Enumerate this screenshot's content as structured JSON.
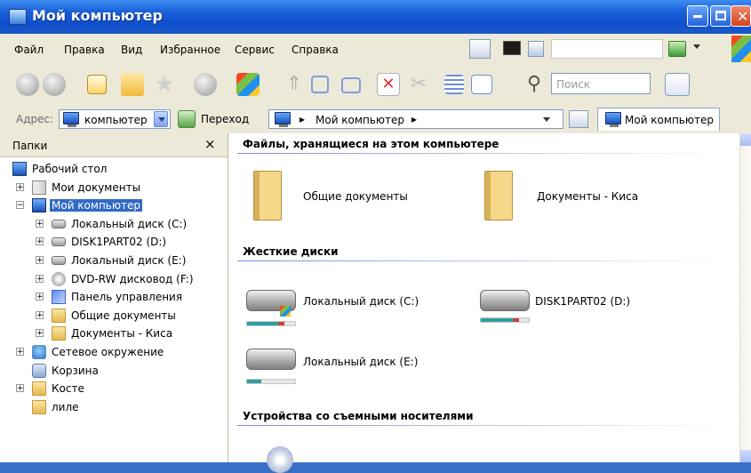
{
  "window": {
    "title": "Мой компьютер"
  },
  "menu": [
    "Файл",
    "Правка",
    "Вид",
    "Избранное",
    "Сервис",
    "Справка"
  ],
  "toolbar": {
    "search_placeholder": "Поиск"
  },
  "address": {
    "label": "Адрес:",
    "combo_value": "компьютер",
    "go_label": "Переход",
    "path": "Мой компьютер",
    "tab": "Мой компьютер"
  },
  "folders_pane": {
    "title": "Папки",
    "close_glyph": "×",
    "tree": [
      {
        "label": "Рабочий стол",
        "icon": "desktop-icon",
        "expander": ""
      },
      {
        "label": "Мои документы",
        "icon": "my-documents-icon",
        "expander": "+"
      },
      {
        "label": "Мой компьютер",
        "icon": "computer-icon",
        "expander": "−",
        "selected": true
      },
      {
        "label": "Локальный диск (C:)",
        "icon": "disk-icon",
        "expander": "+"
      },
      {
        "label": "DISK1PART02 (D:)",
        "icon": "disk-icon",
        "expander": "+"
      },
      {
        "label": "Локальный диск (E:)",
        "icon": "disk-icon",
        "expander": "+"
      },
      {
        "label": "DVD-RW дисковод (F:)",
        "icon": "dvd-icon",
        "expander": "+"
      },
      {
        "label": "Панель управления",
        "icon": "control-panel-icon",
        "expander": "+"
      },
      {
        "label": "Общие документы",
        "icon": "folder-icon",
        "expander": "+"
      },
      {
        "label": "Документы - Киса",
        "icon": "folder-icon",
        "expander": "+"
      },
      {
        "label": "Сетевое окружение",
        "icon": "network-icon",
        "expander": "+"
      },
      {
        "label": "Корзина",
        "icon": "recycle-bin-icon",
        "expander": ""
      },
      {
        "label": "Косте",
        "icon": "folder-icon",
        "expander": "+"
      },
      {
        "label": "лиле",
        "icon": "folder-icon",
        "expander": ""
      }
    ]
  },
  "content": {
    "group_files": "Файлы, хранящиеся на этом компьютере",
    "shared_docs": "Общие документы",
    "kisa_docs": "Документы - Киса",
    "group_disks": "Жесткие диски",
    "disk_c": {
      "label": "Локальный диск (C:)",
      "usage": 0.78
    },
    "disk_d": {
      "label": "DISK1PART02 (D:)",
      "usage": 0.8
    },
    "disk_e": {
      "label": "Локальный диск (E:)",
      "usage": 0.3
    },
    "group_removable": "Устройства со съемными носителями"
  },
  "colors": {
    "usage_fill": "#2f9ea0",
    "usage_full": "#d63b2f",
    "selection": "#316ac5"
  }
}
